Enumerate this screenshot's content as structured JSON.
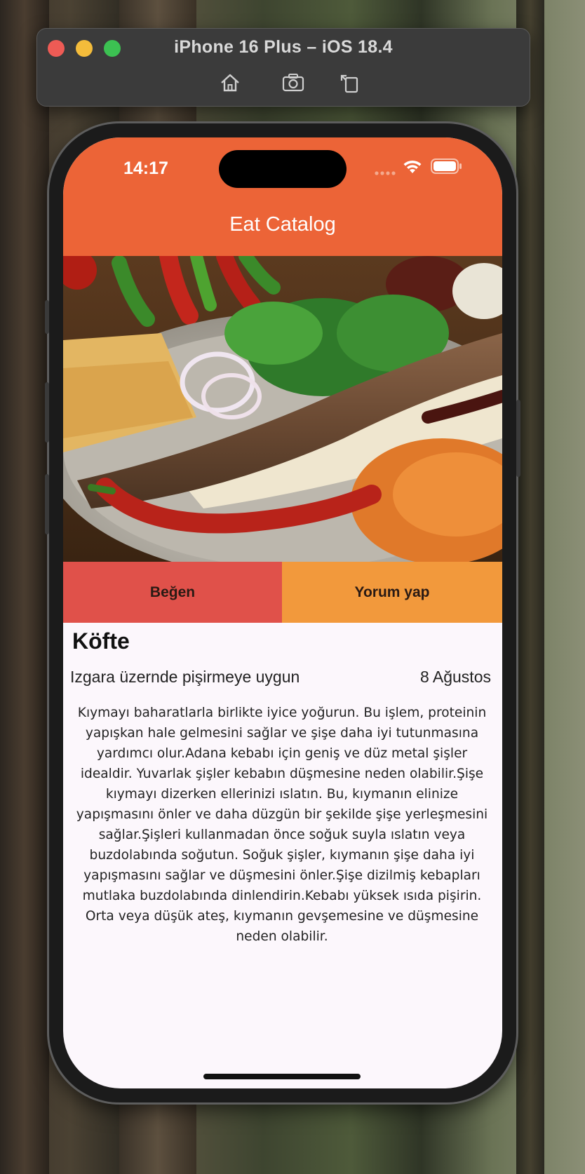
{
  "simulator": {
    "title": "iPhone 16 Plus – iOS 18.4",
    "tools": [
      "home-icon",
      "screenshot-icon",
      "rotate-icon"
    ]
  },
  "status_bar": {
    "time": "14:17"
  },
  "app": {
    "title": "Eat Catalog",
    "accent_color": "#ec6437"
  },
  "actions": {
    "like_label": "Beğen",
    "comment_label": "Yorum yap"
  },
  "food": {
    "name": "Köfte",
    "subtitle": "Izgara üzernde pişirmeye uygun",
    "date": "8 Ağustos",
    "description": "Kıymayı baharatlarla birlikte iyice yoğurun. Bu işlem, proteinin yapışkan hale gelmesini sağlar ve şişe daha iyi tutunmasına yardımcı olur.Adana kebabı için geniş ve düz metal şişler idealdir. Yuvarlak şişler kebabın düşmesine neden olabilir.Şişe kıymayı dizerken ellerinizi ıslatın. Bu, kıymanın elinize yapışmasını önler ve daha düzgün bir şekilde şişe yerleşmesini sağlar.Şişleri kullanmadan önce soğuk suyla ıslatın veya buzdolabında soğutun. Soğuk şişler, kıymanın şişe daha iyi yapışmasını sağlar ve düşmesini önler.Şişe dizilmiş kebapları mutlaka buzdolabında dinlendirin.Kebabı yüksek ısıda pişirin. Orta veya düşük ateş, kıymanın gevşemesine ve düşmesine neden olabilir."
  }
}
